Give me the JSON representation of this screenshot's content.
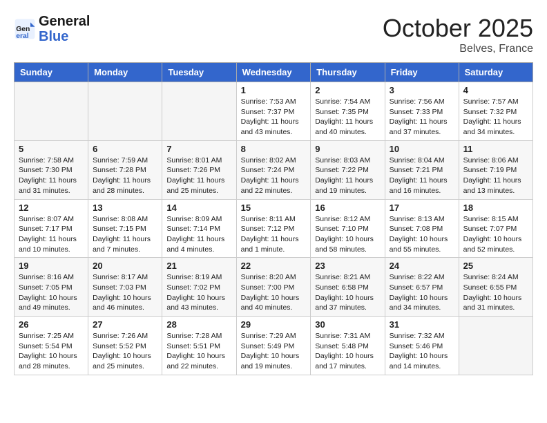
{
  "header": {
    "logo_general": "General",
    "logo_blue": "Blue",
    "month": "October 2025",
    "location": "Belves, France"
  },
  "weekdays": [
    "Sunday",
    "Monday",
    "Tuesday",
    "Wednesday",
    "Thursday",
    "Friday",
    "Saturday"
  ],
  "weeks": [
    [
      {
        "day": "",
        "info": ""
      },
      {
        "day": "",
        "info": ""
      },
      {
        "day": "",
        "info": ""
      },
      {
        "day": "1",
        "info": "Sunrise: 7:53 AM\nSunset: 7:37 PM\nDaylight: 11 hours\nand 43 minutes."
      },
      {
        "day": "2",
        "info": "Sunrise: 7:54 AM\nSunset: 7:35 PM\nDaylight: 11 hours\nand 40 minutes."
      },
      {
        "day": "3",
        "info": "Sunrise: 7:56 AM\nSunset: 7:33 PM\nDaylight: 11 hours\nand 37 minutes."
      },
      {
        "day": "4",
        "info": "Sunrise: 7:57 AM\nSunset: 7:32 PM\nDaylight: 11 hours\nand 34 minutes."
      }
    ],
    [
      {
        "day": "5",
        "info": "Sunrise: 7:58 AM\nSunset: 7:30 PM\nDaylight: 11 hours\nand 31 minutes."
      },
      {
        "day": "6",
        "info": "Sunrise: 7:59 AM\nSunset: 7:28 PM\nDaylight: 11 hours\nand 28 minutes."
      },
      {
        "day": "7",
        "info": "Sunrise: 8:01 AM\nSunset: 7:26 PM\nDaylight: 11 hours\nand 25 minutes."
      },
      {
        "day": "8",
        "info": "Sunrise: 8:02 AM\nSunset: 7:24 PM\nDaylight: 11 hours\nand 22 minutes."
      },
      {
        "day": "9",
        "info": "Sunrise: 8:03 AM\nSunset: 7:22 PM\nDaylight: 11 hours\nand 19 minutes."
      },
      {
        "day": "10",
        "info": "Sunrise: 8:04 AM\nSunset: 7:21 PM\nDaylight: 11 hours\nand 16 minutes."
      },
      {
        "day": "11",
        "info": "Sunrise: 8:06 AM\nSunset: 7:19 PM\nDaylight: 11 hours\nand 13 minutes."
      }
    ],
    [
      {
        "day": "12",
        "info": "Sunrise: 8:07 AM\nSunset: 7:17 PM\nDaylight: 11 hours\nand 10 minutes."
      },
      {
        "day": "13",
        "info": "Sunrise: 8:08 AM\nSunset: 7:15 PM\nDaylight: 11 hours\nand 7 minutes."
      },
      {
        "day": "14",
        "info": "Sunrise: 8:09 AM\nSunset: 7:14 PM\nDaylight: 11 hours\nand 4 minutes."
      },
      {
        "day": "15",
        "info": "Sunrise: 8:11 AM\nSunset: 7:12 PM\nDaylight: 11 hours\nand 1 minute."
      },
      {
        "day": "16",
        "info": "Sunrise: 8:12 AM\nSunset: 7:10 PM\nDaylight: 10 hours\nand 58 minutes."
      },
      {
        "day": "17",
        "info": "Sunrise: 8:13 AM\nSunset: 7:08 PM\nDaylight: 10 hours\nand 55 minutes."
      },
      {
        "day": "18",
        "info": "Sunrise: 8:15 AM\nSunset: 7:07 PM\nDaylight: 10 hours\nand 52 minutes."
      }
    ],
    [
      {
        "day": "19",
        "info": "Sunrise: 8:16 AM\nSunset: 7:05 PM\nDaylight: 10 hours\nand 49 minutes."
      },
      {
        "day": "20",
        "info": "Sunrise: 8:17 AM\nSunset: 7:03 PM\nDaylight: 10 hours\nand 46 minutes."
      },
      {
        "day": "21",
        "info": "Sunrise: 8:19 AM\nSunset: 7:02 PM\nDaylight: 10 hours\nand 43 minutes."
      },
      {
        "day": "22",
        "info": "Sunrise: 8:20 AM\nSunset: 7:00 PM\nDaylight: 10 hours\nand 40 minutes."
      },
      {
        "day": "23",
        "info": "Sunrise: 8:21 AM\nSunset: 6:58 PM\nDaylight: 10 hours\nand 37 minutes."
      },
      {
        "day": "24",
        "info": "Sunrise: 8:22 AM\nSunset: 6:57 PM\nDaylight: 10 hours\nand 34 minutes."
      },
      {
        "day": "25",
        "info": "Sunrise: 8:24 AM\nSunset: 6:55 PM\nDaylight: 10 hours\nand 31 minutes."
      }
    ],
    [
      {
        "day": "26",
        "info": "Sunrise: 7:25 AM\nSunset: 5:54 PM\nDaylight: 10 hours\nand 28 minutes."
      },
      {
        "day": "27",
        "info": "Sunrise: 7:26 AM\nSunset: 5:52 PM\nDaylight: 10 hours\nand 25 minutes."
      },
      {
        "day": "28",
        "info": "Sunrise: 7:28 AM\nSunset: 5:51 PM\nDaylight: 10 hours\nand 22 minutes."
      },
      {
        "day": "29",
        "info": "Sunrise: 7:29 AM\nSunset: 5:49 PM\nDaylight: 10 hours\nand 19 minutes."
      },
      {
        "day": "30",
        "info": "Sunrise: 7:31 AM\nSunset: 5:48 PM\nDaylight: 10 hours\nand 17 minutes."
      },
      {
        "day": "31",
        "info": "Sunrise: 7:32 AM\nSunset: 5:46 PM\nDaylight: 10 hours\nand 14 minutes."
      },
      {
        "day": "",
        "info": ""
      }
    ]
  ]
}
